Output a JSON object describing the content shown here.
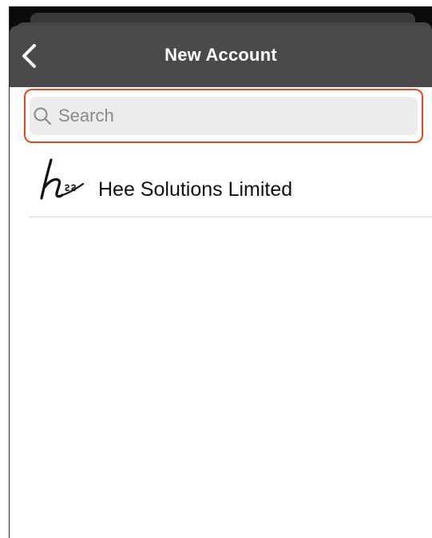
{
  "header": {
    "title": "New Account",
    "back_icon": "chevron-left-icon"
  },
  "search": {
    "placeholder": "Search",
    "value": "",
    "icon": "search-icon",
    "highlight_color": "#e8461f"
  },
  "accounts": [
    {
      "name": "Hee Solutions Limited",
      "logo_text": "hee"
    }
  ],
  "colors": {
    "navbar": "#4a4a4a",
    "search_bg": "#ececec"
  }
}
